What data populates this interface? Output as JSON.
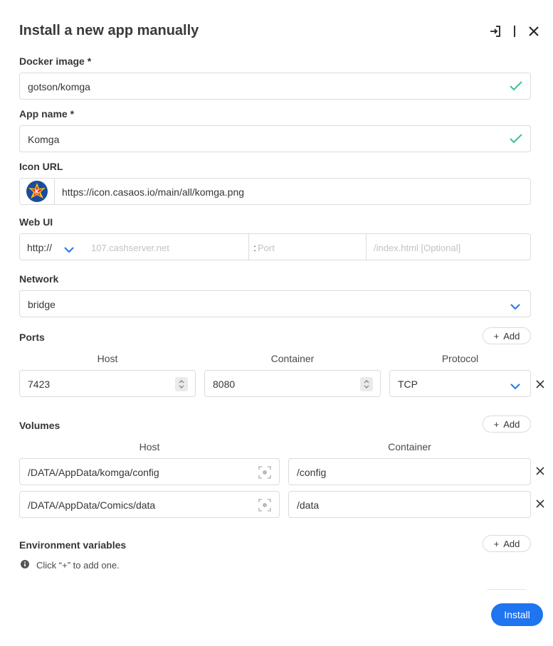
{
  "header": {
    "title": "Install a new app manually",
    "import_icon": "import-icon",
    "close_icon": "close-icon"
  },
  "docker_image": {
    "label": "Docker image *",
    "value": "gotson/komga",
    "status_icon": "check-icon"
  },
  "app_name": {
    "label": "App name *",
    "value": "Komga",
    "status_icon": "check-icon"
  },
  "icon_url": {
    "label": "Icon URL",
    "value": "https://icon.casaos.io/main/all/komga.png",
    "preview_icon": "komga-logo-icon"
  },
  "web_ui": {
    "label": "Web UI",
    "scheme": "http://",
    "host_placeholder": "107.cashserver.net",
    "port_prefix": ":",
    "port_placeholder": "Port",
    "path_placeholder": "/index.html [Optional]"
  },
  "network": {
    "label": "Network",
    "value": "bridge"
  },
  "ports": {
    "label": "Ports",
    "add_label": "Add",
    "columns": [
      "Host",
      "Container",
      "Protocol"
    ],
    "rows": [
      {
        "host": "7423",
        "container": "8080",
        "protocol": "TCP"
      }
    ]
  },
  "volumes": {
    "label": "Volumes",
    "add_label": "Add",
    "columns": [
      "Host",
      "Container"
    ],
    "rows": [
      {
        "host": "/DATA/AppData/komga/config",
        "container": "/config"
      },
      {
        "host": "/DATA/AppData/Comics/data",
        "container": "/data"
      }
    ]
  },
  "env": {
    "label": "Environment variables",
    "add_label": "Add",
    "hint": "Click “+” to add one."
  },
  "footer": {
    "install_label": "Install"
  },
  "colors": {
    "accent": "#1f74f0",
    "check": "#3cc18c"
  }
}
